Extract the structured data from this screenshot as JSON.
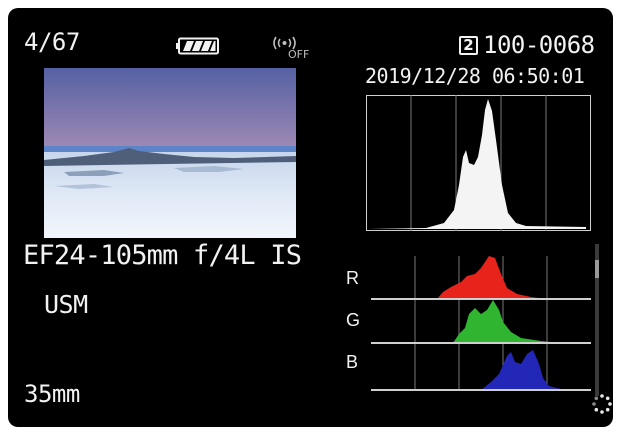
{
  "status_bar": {
    "image_counter": "4/67",
    "battery_icon": "battery-full-icon",
    "wifi_icon": "wifi-off-icon",
    "wifi_state": "OFF",
    "card_slot": "2",
    "file_number": "100-0068"
  },
  "datetime": "2019/12/28 06:50:01",
  "lens": {
    "line1": "EF24-105mm f/4L IS",
    "line2": "USM"
  },
  "focal_length": "35mm",
  "histograms": {
    "channels": [
      {
        "label": "R",
        "color": "#e8231c"
      },
      {
        "label": "G",
        "color": "#2fb52f"
      },
      {
        "label": "B",
        "color": "#2327b8"
      }
    ],
    "luminance_color": "#f4f4f4"
  }
}
